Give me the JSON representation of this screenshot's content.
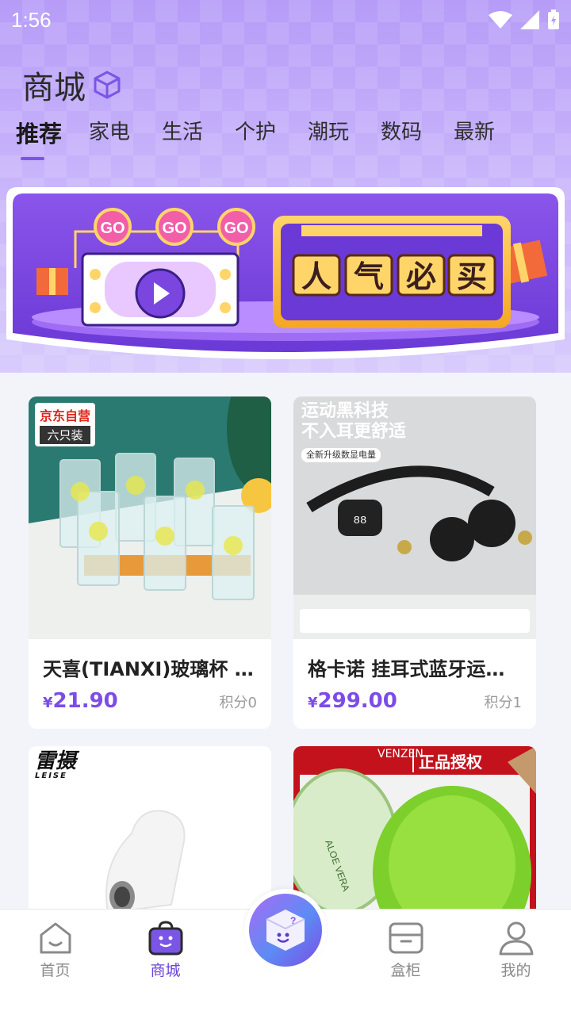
{
  "status": {
    "time": "1:56"
  },
  "header": {
    "title": "商城"
  },
  "tabs": [
    {
      "label": "推荐",
      "active": true
    },
    {
      "label": "家电"
    },
    {
      "label": "生活"
    },
    {
      "label": "个护"
    },
    {
      "label": "潮玩"
    },
    {
      "label": "数码"
    },
    {
      "label": "最新"
    }
  ],
  "banner": {
    "go_labels": [
      "GO",
      "GO",
      "GO"
    ],
    "headline_chars": [
      "人",
      "气",
      "必",
      "买"
    ]
  },
  "products": [
    {
      "title": "天喜(TIANXI)玻璃杯 六只装水杯",
      "price_symbol": "¥",
      "price": "21.90",
      "points": "积分0",
      "badge_line1": "京东自营",
      "badge_line2": "六只装"
    },
    {
      "title": "格卡诺 挂耳式蓝牙运动耳机",
      "price_symbol": "¥",
      "price": "299.00",
      "points": "积分1",
      "promo_line1": "运动黑科技",
      "promo_line2": "不入耳更舒适",
      "promo_tag": "全新升级数显电量",
      "display_digits": "88"
    },
    {
      "title": "",
      "brand_logo": "雷摄",
      "brand_sub": "LEISE"
    },
    {
      "title": "",
      "brand_logo": "VENZEN",
      "brand_tag": "正品授权",
      "jar_label": "ALOE VERA"
    }
  ],
  "nav": {
    "items": [
      {
        "label": "首页",
        "icon": "home-icon"
      },
      {
        "label": "商城",
        "icon": "shop-bag-icon",
        "active": true
      },
      {
        "label": "盒柜",
        "icon": "cabinet-icon"
      },
      {
        "label": "我的",
        "icon": "profile-icon"
      }
    ]
  },
  "colors": {
    "accent": "#7c4ce8",
    "header": "#b69cf7",
    "banner_purple": "#7b46e0"
  }
}
